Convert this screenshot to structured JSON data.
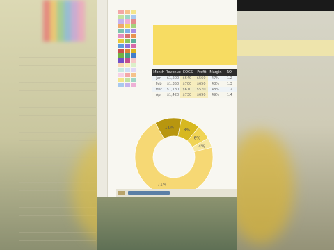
{
  "sheet": {
    "palette_colors": [
      "#f3a7a7",
      "#f6c28b",
      "#f3e58b",
      "#c3e3a1",
      "#9fd6c6",
      "#a9c9ef",
      "#c6b2ee",
      "#eeb0d6",
      "#e58c8c",
      "#f0a96a",
      "#efd85c",
      "#a6d37d",
      "#7cc2ae",
      "#7fb0e6",
      "#a98ee6",
      "#e48cc0",
      "#d96f6f",
      "#e99350",
      "#e8c83a",
      "#8bc45d",
      "#5fb29b",
      "#5e9bde",
      "#8d6fdc",
      "#d86aa9",
      "#c94f4f",
      "#df7e35",
      "#dcb523",
      "#70b244",
      "#469f86",
      "#437fcc",
      "#7250c8",
      "#c14d91",
      "#f7c9c9",
      "#fad7b3",
      "#f8efb7",
      "#dcf0c9",
      "#c8ebe1",
      "#cfe0f7",
      "#e0d6f7",
      "#f6d1e7",
      "#f3a7a7",
      "#f6c28b",
      "#f3e58b",
      "#c3e3a1",
      "#9fd6c6",
      "#a9c9ef",
      "#c6b2ee",
      "#eeb0d6"
    ]
  },
  "table": {
    "headers": [
      "Month",
      "Revenue",
      "COGS",
      "Profit",
      "Margin",
      "ROI"
    ],
    "rows": [
      [
        "Jan",
        "$1,200",
        "$640",
        "$560",
        "47%",
        "1.2"
      ],
      [
        "Feb",
        "$1,350",
        "$700",
        "$650",
        "48%",
        "1.3"
      ],
      [
        "Mar",
        "$1,180",
        "$610",
        "$570",
        "48%",
        "1.2"
      ],
      [
        "Apr",
        "$1,420",
        "$730",
        "$690",
        "49%",
        "1.4"
      ]
    ]
  },
  "donut": {
    "segments": [
      {
        "label": "11%",
        "value": 11,
        "color": "#b8960f"
      },
      {
        "label": "8%",
        "value": 8,
        "color": "#d7b820"
      },
      {
        "label": "6%",
        "value": 6,
        "color": "#f0d455"
      },
      {
        "label": "4%",
        "value": 4,
        "color": "#f7e8a0"
      },
      {
        "label": "71%",
        "value": 71,
        "color": "#f6d874"
      }
    ]
  }
}
